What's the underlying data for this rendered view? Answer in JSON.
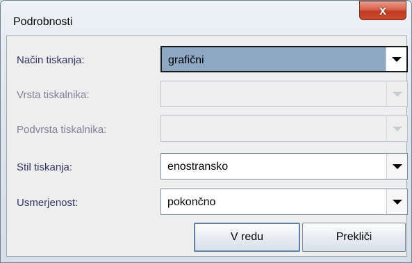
{
  "window": {
    "title": "Podrobnosti",
    "close_glyph": "x"
  },
  "form": {
    "fields": [
      {
        "label": "Način tiskanja:",
        "value": "grafični",
        "state": "selected"
      },
      {
        "label": "Vrsta tiskalnika:",
        "value": "",
        "state": "disabled"
      },
      {
        "label": "Podvrsta tiskalnika:",
        "value": "",
        "state": "disabled"
      },
      {
        "label": "Stil tiskanja:",
        "value": "enostransko",
        "state": "enabled"
      },
      {
        "label": "Usmerjenost:",
        "value": "pokončno",
        "state": "enabled"
      }
    ]
  },
  "buttons": {
    "ok_label": "V redu",
    "cancel_label": "Prekliči"
  },
  "colors": {
    "selection": "#8ea8c4",
    "label": "#333366",
    "close": "#c94b30"
  }
}
